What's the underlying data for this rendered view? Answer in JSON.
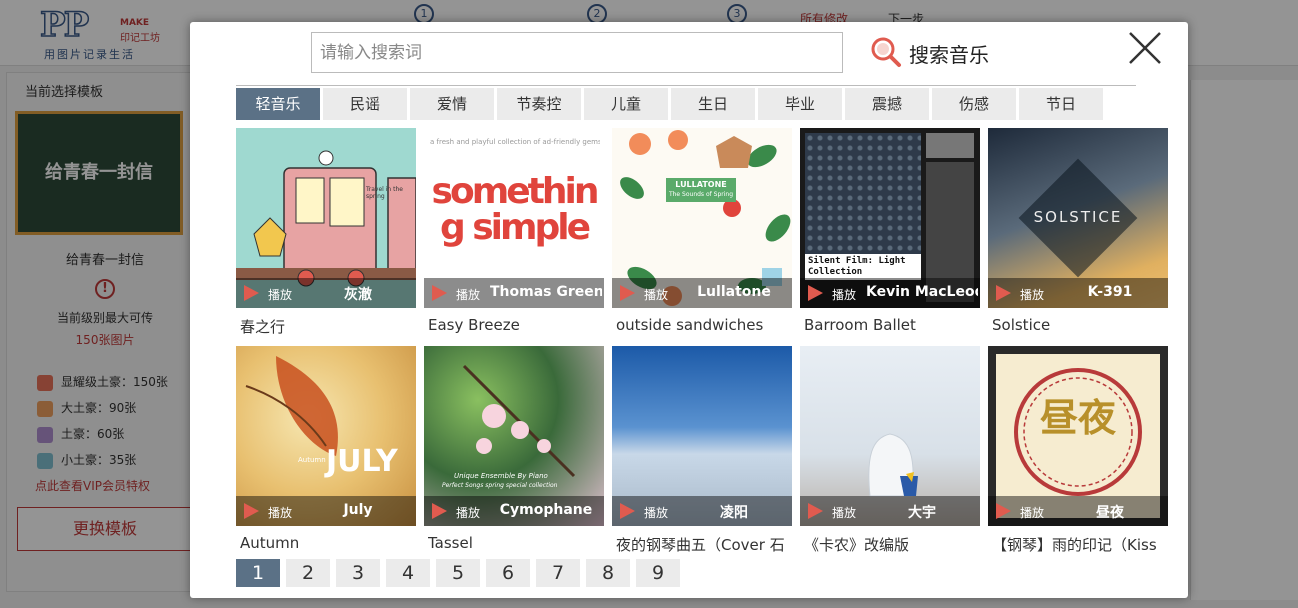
{
  "background": {
    "logo": {
      "mark": "PP",
      "make": "MAKE",
      "brand": "印记工坊",
      "slogan": "用图片记录生活"
    },
    "steps": [
      "1",
      "2",
      "3"
    ],
    "top_links": [
      "所有修改",
      "下一步"
    ],
    "sidebar": {
      "title": "当前选择模板",
      "template_thumb_text": "给青春一封信",
      "template_name": "给青春一封信",
      "warning_symbol": "!",
      "max_upload_text": "当前级别最大可传",
      "max_upload_count": "150张图片",
      "levels": [
        {
          "label": "显耀级土豪：150张",
          "color": "#e8735a"
        },
        {
          "label": "大土豪：90张",
          "color": "#f0a060"
        },
        {
          "label": "土豪：60张",
          "color": "#b090d0"
        },
        {
          "label": "小土豪：35张",
          "color": "#80c0d0"
        }
      ],
      "vip_link": "点此查看VIP会员特权",
      "change_template_button": "更换模板"
    }
  },
  "modal": {
    "search": {
      "placeholder": "请输入搜索词",
      "button_label": "搜索音乐"
    },
    "tabs": [
      {
        "label": "轻音乐",
        "active": true
      },
      {
        "label": "民谣"
      },
      {
        "label": "爱情"
      },
      {
        "label": "节奏控"
      },
      {
        "label": "儿童"
      },
      {
        "label": "生日"
      },
      {
        "label": "毕业"
      },
      {
        "label": "震撼"
      },
      {
        "label": "伤感"
      },
      {
        "label": "节日"
      }
    ],
    "play_label": "播放",
    "songs": [
      {
        "title": "春之行",
        "artist": "灰澈",
        "cover_text": "Travel in the spring"
      },
      {
        "title": "Easy Breeze",
        "artist": "Thomas Greenberg",
        "cover_text": "something simple",
        "cover_subtext": "a fresh and playful collection of ad-friendly gems"
      },
      {
        "title": "outside sandwiches",
        "artist": "Lullatone",
        "cover_text": "LULLATONE",
        "cover_subtext": "The Sounds of Spring"
      },
      {
        "title": "Barroom Ballet",
        "artist": "Kevin MacLeod",
        "cover_text": "Silent Film: Light Collection"
      },
      {
        "title": "Solstice",
        "artist": "K-391",
        "cover_text": "SOLSTICE"
      },
      {
        "title": "Autumn",
        "artist": "July",
        "cover_text": "JULY",
        "cover_subtext": "Autumn"
      },
      {
        "title": "Tassel",
        "artist": "Cymophane",
        "cover_text": "Unique Ensemble By Piano",
        "cover_subtext": "Perfect Songs spring special collection"
      },
      {
        "title": "夜的钢琴曲五（Cover 石",
        "artist": "凌阳"
      },
      {
        "title": "《卡农》改编版",
        "artist": "大宇"
      },
      {
        "title": "【钢琴】雨的印记（Kiss",
        "artist": "昼夜",
        "cover_text": "昼夜"
      }
    ],
    "pagination": [
      {
        "label": "1",
        "active": true
      },
      {
        "label": "2"
      },
      {
        "label": "3"
      },
      {
        "label": "4"
      },
      {
        "label": "5"
      },
      {
        "label": "6"
      },
      {
        "label": "7"
      },
      {
        "label": "8"
      },
      {
        "label": "9"
      }
    ]
  }
}
